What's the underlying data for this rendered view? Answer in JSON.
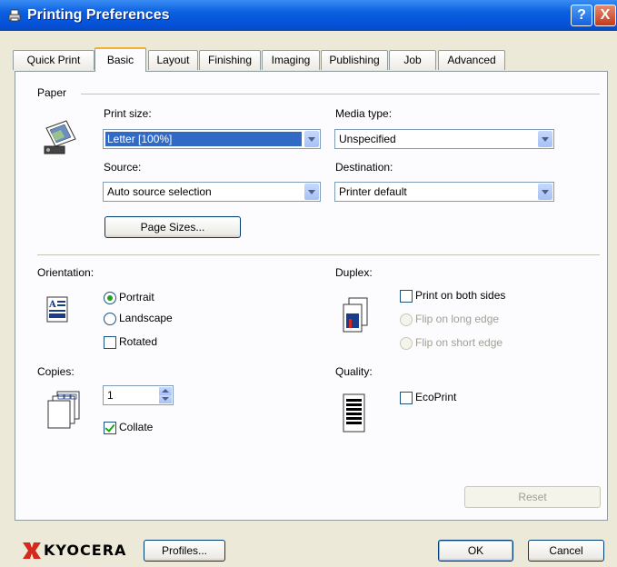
{
  "window": {
    "title": "Printing Preferences",
    "help_glyph": "?",
    "close_glyph": "X"
  },
  "tabs": [
    {
      "label": "Quick Print"
    },
    {
      "label": "Basic"
    },
    {
      "label": "Layout"
    },
    {
      "label": "Finishing"
    },
    {
      "label": "Imaging"
    },
    {
      "label": "Publishing"
    },
    {
      "label": "Job"
    },
    {
      "label": "Advanced"
    }
  ],
  "active_tab": "Basic",
  "paper": {
    "group_label": "Paper",
    "print_size_label": "Print size:",
    "print_size_value": "Letter [100%]",
    "source_label": "Source:",
    "source_value": "Auto source selection",
    "media_type_label": "Media type:",
    "media_type_value": "Unspecified",
    "destination_label": "Destination:",
    "destination_value": "Printer default",
    "page_sizes_button": "Page Sizes..."
  },
  "orientation": {
    "group_label": "Orientation:",
    "portrait": "Portrait",
    "landscape": "Landscape",
    "rotated": "Rotated",
    "selected": "Portrait",
    "rotated_checked": false
  },
  "duplex": {
    "group_label": "Duplex:",
    "print_both_sides": "Print on both sides",
    "flip_long": "Flip on long edge",
    "flip_short": "Flip on short edge",
    "print_both_sides_checked": false
  },
  "copies": {
    "group_label": "Copies:",
    "value": "1",
    "collate": "Collate",
    "collate_checked": true
  },
  "quality": {
    "group_label": "Quality:",
    "ecoprint": "EcoPrint",
    "ecoprint_checked": false
  },
  "reset_button": "Reset",
  "footer": {
    "brand": "KYOCERA",
    "profiles_button": "Profiles...",
    "ok_button": "OK",
    "cancel_button": "Cancel"
  },
  "colors": {
    "title_bar": "#0550d6",
    "dialog_bg": "#ece9d8",
    "brand_red": "#d42a1e"
  }
}
